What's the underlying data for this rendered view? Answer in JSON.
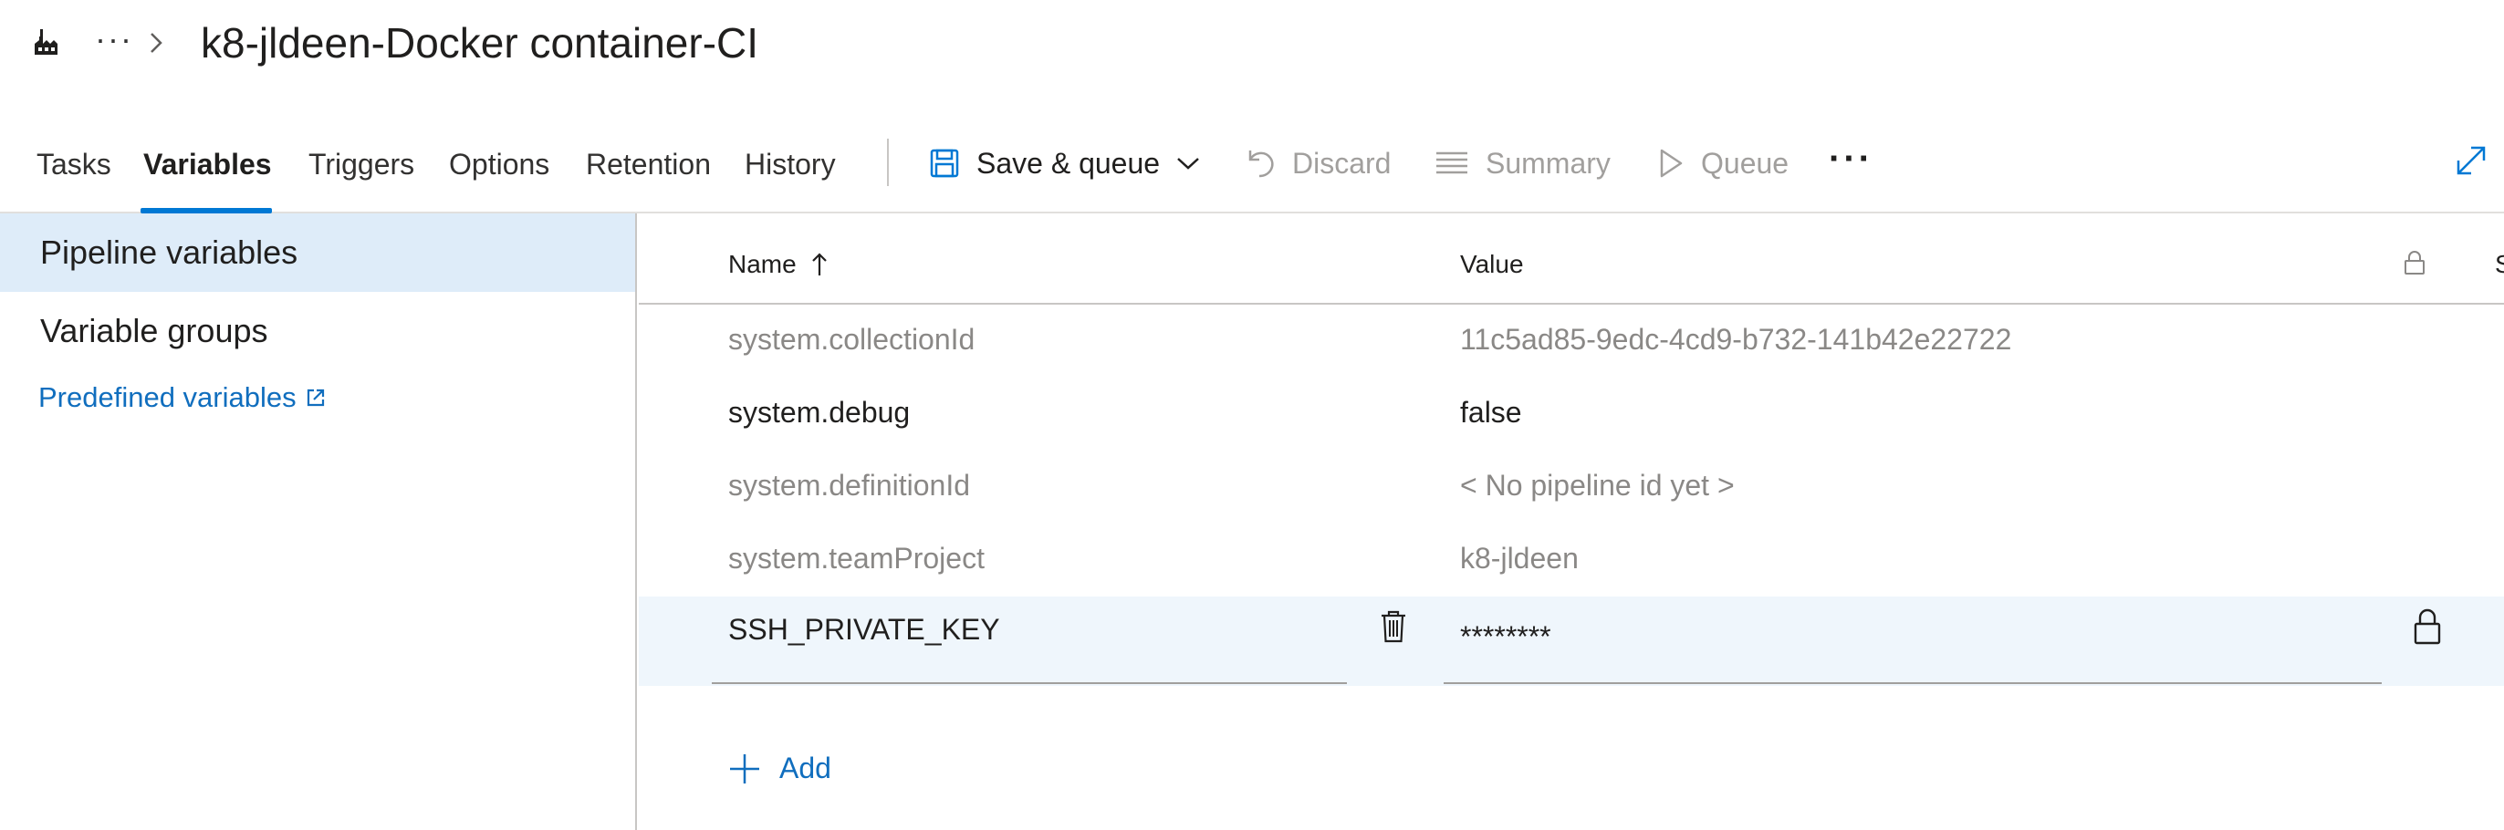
{
  "header": {
    "breadcrumb_more": "···",
    "title": "k8-jldeen-Docker container-CI"
  },
  "tabs": [
    {
      "label": "Tasks"
    },
    {
      "label": "Variables"
    },
    {
      "label": "Triggers"
    },
    {
      "label": "Options"
    },
    {
      "label": "Retention"
    },
    {
      "label": "History"
    }
  ],
  "active_tab": "Variables",
  "commands": {
    "save_queue": "Save & queue",
    "discard": "Discard",
    "summary": "Summary",
    "queue": "Queue",
    "more": "···"
  },
  "sidebar": {
    "items": [
      {
        "label": "Pipeline variables"
      },
      {
        "label": "Variable groups"
      }
    ],
    "selected": "Pipeline variables",
    "predefined_link": "Predefined variables"
  },
  "grid": {
    "columns": {
      "name": "Name",
      "value": "Value",
      "secret_clipped": "S"
    },
    "rows": [
      {
        "name": "system.collectionId",
        "value": "11c5ad85-9edc-4cd9-b732-141b42e22722",
        "editable": false
      },
      {
        "name": "system.debug",
        "value": "false",
        "editable": true
      },
      {
        "name": "system.definitionId",
        "value": "< No pipeline id yet >",
        "editable": false
      },
      {
        "name": "system.teamProject",
        "value": "k8-jldeen",
        "editable": false
      },
      {
        "name": "SSH_PRIVATE_KEY",
        "value": "********",
        "editable": true,
        "secret": true
      }
    ],
    "add_label": "Add"
  },
  "colors": {
    "accent": "#0078d4",
    "link": "#106ebe",
    "selected_bg": "#deecf9",
    "row_selected_bg": "#eff6fc",
    "disabled_text": "#a19f9d"
  }
}
